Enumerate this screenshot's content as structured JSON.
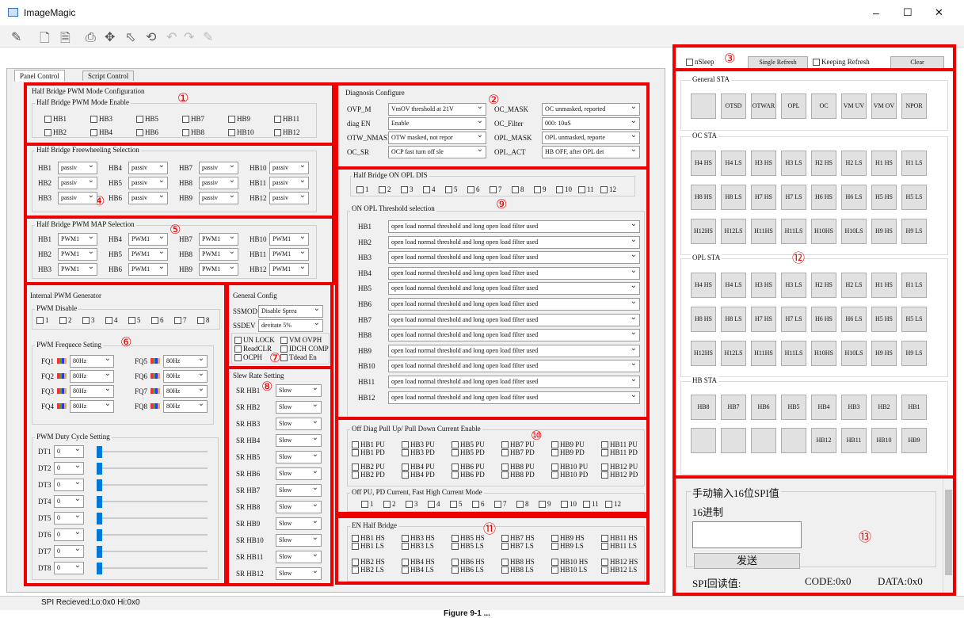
{
  "window": {
    "title": "ImageMagic",
    "minimize": "–",
    "maximize": "☐",
    "close": "✕"
  },
  "tabs": [
    "Panel Control",
    "Script Control"
  ],
  "hbmode": {
    "title": "Half Bridge PWM Mode Configuration",
    "sub": "Half Bridge PWM Mode Enable",
    "items": [
      "HB1",
      "HB3",
      "HB5",
      "HB7",
      "HB9",
      "HB11",
      "HB2",
      "HB4",
      "HB6",
      "HB8",
      "HB10",
      "HB12"
    ]
  },
  "freewheel": {
    "title": "Half Bridge Freewheeling Selection",
    "rows": [
      [
        "HB1",
        "HB4",
        "HB7",
        "HB10"
      ],
      [
        "HB2",
        "HB5",
        "HB8",
        "HB11"
      ],
      [
        "HB3",
        "HB6",
        "HB9",
        "HB12"
      ]
    ],
    "value": "passiv"
  },
  "pwmmap": {
    "title": "Half Bridge PWM MAP Selection",
    "rows": [
      [
        "HB1",
        "HB4",
        "HB7",
        "HB10"
      ],
      [
        "HB2",
        "HB5",
        "HB8",
        "HB11"
      ],
      [
        "HB3",
        "HB6",
        "HB9",
        "HB12"
      ]
    ],
    "value": "PWM1"
  },
  "intpwm": {
    "title": "Internal PWM Generator",
    "disable": "PWM Disable",
    "nums": [
      "1",
      "2",
      "3",
      "4",
      "5",
      "6",
      "7",
      "8"
    ],
    "freq_title": "PWM Frequece Seting",
    "freqs": [
      "FQ1",
      "FQ2",
      "FQ3",
      "FQ4",
      "FQ5",
      "FQ6",
      "FQ7",
      "FQ8"
    ],
    "freq_val": "80Hz",
    "duty_title": "PWM Duty Cycle Setting",
    "duties": [
      "DT1",
      "DT2",
      "DT3",
      "DT4",
      "DT5",
      "DT6",
      "DT7",
      "DT8"
    ],
    "duty_val": "0"
  },
  "genconfig": {
    "title": "General Config",
    "ssmod": "SSMOD",
    "ssmod_val": "Disable Sprea",
    "ssdev": "SSDEV",
    "ssdev_val": "devitate 5%",
    "checks": [
      "UN LOCK",
      "VM OVPH",
      "ReadCLR",
      "IDCH COMP",
      "OCPH",
      "Tdead En"
    ]
  },
  "slew": {
    "title": "Slew Rate Setting",
    "items": [
      "SR HB1",
      "SR HB2",
      "SR HB3",
      "SR HB4",
      "SR HB5",
      "SR HB6",
      "SR HB7",
      "SR HB8",
      "SR HB9",
      "SR HB10",
      "SR HB11",
      "SR HB12"
    ],
    "value": "Slow"
  },
  "diag": {
    "title": "Diagnosis Configure",
    "rows": [
      [
        "OVP_M",
        "VmOV threshold at 21V",
        "OC_MASK",
        "OC unmasked, reported"
      ],
      [
        "diag EN",
        "Enable",
        "OC_Filter",
        "000: 10uS"
      ],
      [
        "OTW_NMASK",
        "OTW masked, not repor",
        "OPL_MASK",
        "OPL unmasked, reporte"
      ],
      [
        "OC_SR",
        "OCP fast turn off sle",
        "OPL_ACT",
        "HB OFF, after OPL det"
      ]
    ]
  },
  "opldis": {
    "title": "Half Bridge ON OPL DIS",
    "nums": [
      "1",
      "2",
      "3",
      "4",
      "5",
      "6",
      "7",
      "8",
      "9",
      "10",
      "11",
      "12"
    ]
  },
  "oplth": {
    "title": "ON OPL Threshold selection",
    "items": [
      "HB1",
      "HB2",
      "HB3",
      "HB4",
      "HB5",
      "HB6",
      "HB7",
      "HB8",
      "HB9",
      "HB10",
      "HB11",
      "HB12"
    ],
    "value": "open load normal threshold and long open load filter used"
  },
  "offdiag": {
    "title": "Off Diag Pull Up/ Pull Down Current Enable",
    "rows": [
      [
        "HB1 PU",
        "HB3 PU",
        "HB5 PU",
        "HB7 PU",
        "HB9 PU",
        "HB11 PU"
      ],
      [
        "HB1 PD",
        "HB3 PD",
        "HB5 PD",
        "HB7 PD",
        "HB9 PD",
        "HB11 PD"
      ],
      [
        "HB2 PU",
        "HB4 PU",
        "HB6 PU",
        "HB8 PU",
        "HB10 PU",
        "HB12 PU"
      ],
      [
        "HB2 PD",
        "HB4 PD",
        "HB6 PD",
        "HB8 PD",
        "HB10 PD",
        "HB12 PD"
      ]
    ],
    "fast_title": "Off PU, PD Current, Fast High Current Mode",
    "nums": [
      "1",
      "2",
      "3",
      "4",
      "5",
      "6",
      "7",
      "8",
      "9",
      "10",
      "11",
      "12"
    ]
  },
  "enhb": {
    "title": "EN Half Bridge",
    "rows": [
      [
        "HB1 HS",
        "HB3 HS",
        "HB5 HS",
        "HB7 HS",
        "HB9 HS",
        "HB11 HS"
      ],
      [
        "HB1 LS",
        "HB3 LS",
        "HB5 LS",
        "HB7 LS",
        "HB9 LS",
        "HB11 LS"
      ],
      [
        "HB2 HS",
        "HB4 HS",
        "HB6 HS",
        "HB8 HS",
        "HB10 HS",
        "HB12 HS"
      ],
      [
        "HB2 LS",
        "HB4 LS",
        "HB6 LS",
        "HB8 LS",
        "HB10 LS",
        "HB12 LS"
      ]
    ]
  },
  "right": {
    "nsleep": "nSleep",
    "single": "Single Refresh",
    "keeping": "Keeping Refresh",
    "clear": "Clear"
  },
  "status": {
    "general": "General STA",
    "general_btns": [
      "",
      "OTSD",
      "OTWAR",
      "OPL",
      "OC",
      "VM UV",
      "VM OV",
      "NPOR"
    ],
    "oc": "OC STA",
    "opl": "OPL STA",
    "rows": [
      [
        "H4 HS",
        "H4 LS",
        "H3 HS",
        "H3 LS",
        "H2 HS",
        "H2 LS",
        "H1 HS",
        "H1 LS"
      ],
      [
        "H8 HS",
        "H8 LS",
        "H7 HS",
        "H7 LS",
        "H6 HS",
        "H6 LS",
        "H5 HS",
        "H5 LS"
      ],
      [
        "H12HS",
        "H12LS",
        "H11HS",
        "H11LS",
        "H10HS",
        "H10LS",
        "H9 HS",
        "H9 LS"
      ]
    ],
    "hb": "HB STA",
    "hb_row1": [
      "HB8",
      "HB7",
      "HB6",
      "HB5",
      "HB4",
      "HB3",
      "HB2",
      "HB1"
    ],
    "hb_row2": [
      "",
      "",
      "",
      "",
      "HB12",
      "HB11",
      "HB10",
      "HB9"
    ]
  },
  "spi": {
    "title": "手动输入16位SPI值",
    "hex": "16进制",
    "send": "发送",
    "readback": "SPI回读值:",
    "code": "CODE:0x0",
    "data": "DATA:0x0"
  },
  "statusbar": {
    "text": "SPI Recieved:Lo:0x0 Hi:0x0"
  },
  "caption": "Figure 9-1 ..."
}
